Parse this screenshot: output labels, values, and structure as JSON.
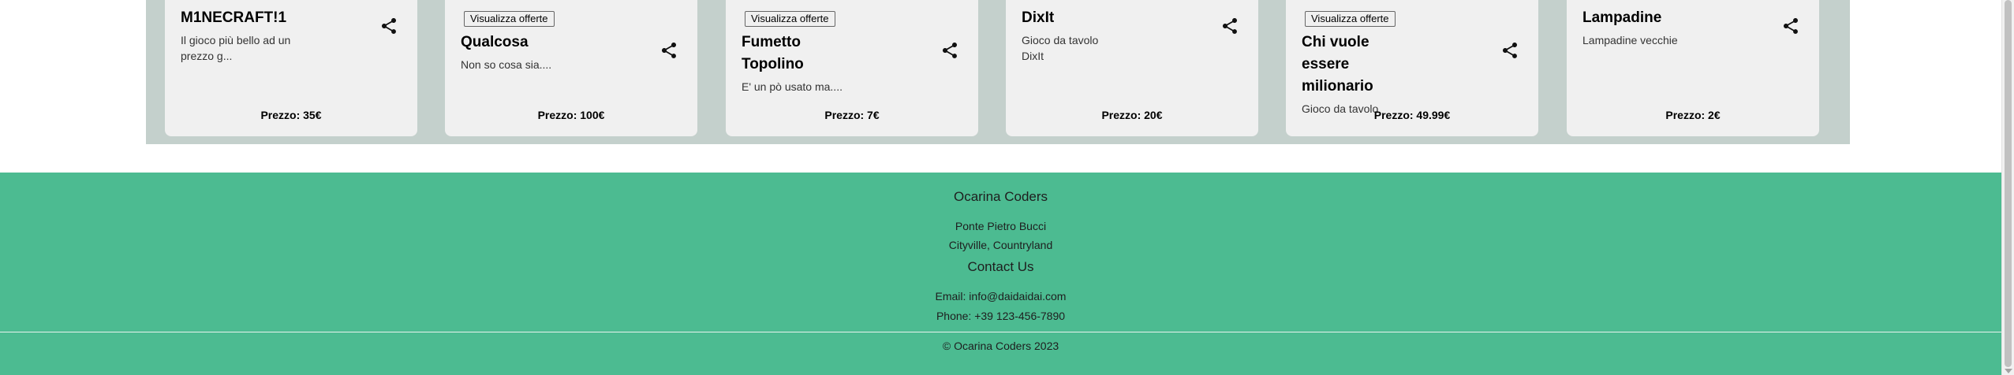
{
  "products": [
    {
      "offers_label": "",
      "title": "M1NECRAFT!1",
      "description": "Il gioco più bello ad un prezzo g...",
      "price": "Prezzo: 35€"
    },
    {
      "offers_label": "Visualizza offerte",
      "title": "Qualcosa",
      "description": "Non so cosa sia....",
      "price": "Prezzo: 100€"
    },
    {
      "offers_label": "Visualizza offerte",
      "title": "Fumetto Topolino",
      "description": "E' un pò usato ma....",
      "price": "Prezzo: 7€"
    },
    {
      "offers_label": "",
      "title": "DixIt",
      "description": "Gioco da tavolo DixIt",
      "price": "Prezzo: 20€"
    },
    {
      "offers_label": "Visualizza offerte",
      "title": "Chi vuole essere milionario",
      "description": "Gioco da tavolo",
      "price": "Prezzo: 49.99€"
    },
    {
      "offers_label": "",
      "title": "Lampadine",
      "description": "Lampadine vecchie",
      "price": "Prezzo: 2€"
    }
  ],
  "icons": {
    "share": "share-icon"
  },
  "footer": {
    "company_name": "Ocarina Coders",
    "address_line1": "Ponte Pietro Bucci",
    "address_line2": "Cityville, Countryland",
    "contact_heading": "Contact Us",
    "email": "Email: info@daidaidai.com",
    "phone": "Phone: +39 123-456-7890",
    "copyright": "© Ocarina Coders 2023"
  },
  "colors": {
    "footer_bg": "#4cbb91",
    "section_bg": "#c4d0cc",
    "card_bg": "#f0f0f0"
  }
}
